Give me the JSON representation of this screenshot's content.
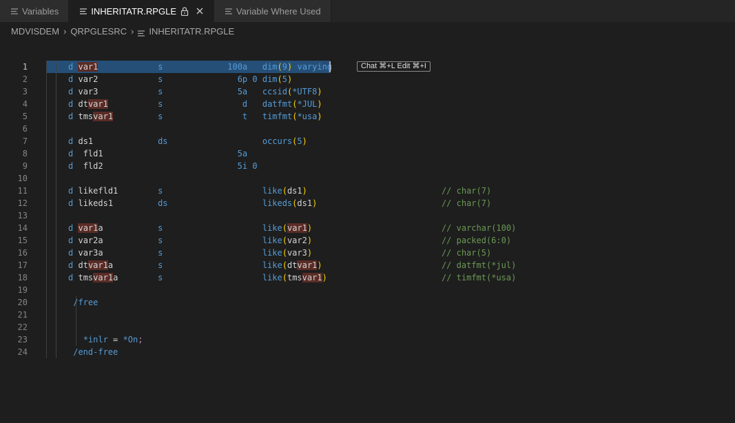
{
  "tabs": [
    {
      "label": "Variables",
      "icon": "lines-icon",
      "active": false
    },
    {
      "label": "INHERITATR.RPGLE",
      "icon": "lines-icon",
      "active": true
    },
    {
      "label": "Variable Where Used",
      "icon": "lines-icon",
      "active": false
    }
  ],
  "breadcrumb": {
    "library": "MDVISDEM",
    "file": "QRPGLESRC",
    "member": "INHERITATR.RPGLE"
  },
  "editor": {
    "current_line": 1,
    "inline_hint": "Chat ⌘+L Edit ⌘+I",
    "line_numbers": [
      "1",
      "2",
      "3",
      "4",
      "5",
      "6",
      "7",
      "8",
      "9",
      "10",
      "11",
      "12",
      "13",
      "14",
      "15",
      "16",
      "17",
      "18",
      "19",
      "20",
      "21",
      "22",
      "23",
      "24"
    ],
    "lines": [
      "    d var1            s             100a   dim(9) varying",
      "    d var2            s               6p 0 dim(5)",
      "    d var3            s               5a   ccsid(*UTF8)",
      "    d dtvar1          s                d   datfmt(*JUL)",
      "    d tmsvar1         s                t   timfmt(*usa)",
      "",
      "    d ds1             ds                   occurs(5)",
      "    d  fld1                           5a",
      "    d  fld2                           5i 0",
      "",
      "    d likefld1        s                    like(ds1)                           // char(7)",
      "    d likeds1         ds                   likeds(ds1)                         // char(7)",
      "",
      "    d var1a           s                    like(var1)                          // varchar(100)",
      "    d var2a           s                    like(var2)                          // packed(6:0)",
      "    d var3a           s                    like(var3)                          // char(5)",
      "    d dtvar1a         s                    like(dtvar1)                        // datfmt(*jul)",
      "    d tmsvar1a        s                    like(tmsvar1)                       // timfmt(*usa)",
      "",
      "     /free",
      "",
      "",
      "       *inlr = *On;",
      "     /end-free"
    ]
  },
  "colors": {
    "background": "#1e1e1e",
    "keyword": "#569cd6",
    "comment": "#6a9955",
    "bracket": "#ffd700",
    "selection": "#264f78",
    "occurrence_highlight": "#5b2c26"
  }
}
